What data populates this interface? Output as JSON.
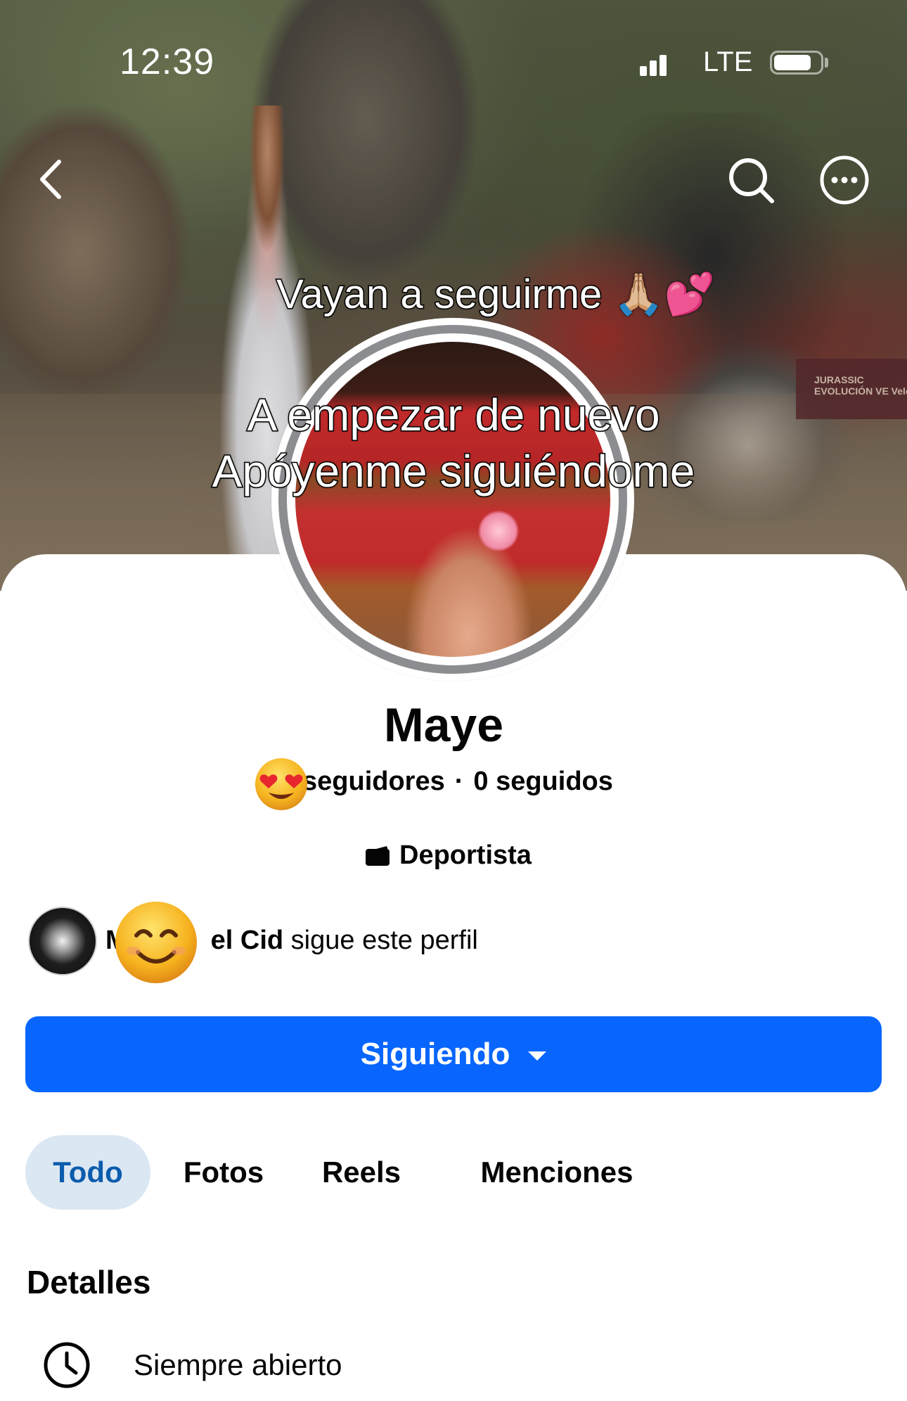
{
  "status_bar": {
    "time": "12:39",
    "network": "LTE"
  },
  "nav": {
    "back_icon": "chevron-left-icon",
    "search_icon": "search-icon",
    "more_icon": "more-horizontal-icon"
  },
  "cover": {
    "text_line_1": "Vayan a seguirme 🙏🏼💕",
    "text_line_2": "A empezar de nuevo",
    "text_line_3": "Apóyenme siguiéndome",
    "sign_text": "JURASSIC EVOLUCIÓN VE Velo"
  },
  "profile": {
    "name": "Maye",
    "followers_label": "seguidores",
    "separator": "·",
    "following_label": "0 seguidos",
    "category": "Deportista",
    "category_icon": "film-icon"
  },
  "mutual": {
    "name_prefix": "M",
    "name_suffix": "el Cid",
    "text": " sigue este perfil"
  },
  "actions": {
    "following_button": "Siguiendo"
  },
  "tabs": [
    {
      "label": "Todo",
      "active": true
    },
    {
      "label": "Fotos",
      "active": false
    },
    {
      "label": "Reels",
      "active": false
    },
    {
      "label": "Menciones",
      "active": false
    }
  ],
  "details": {
    "title": "Detalles",
    "items": [
      {
        "icon": "clock-icon",
        "text": "Siempre abierto"
      }
    ]
  },
  "colors": {
    "primary": "#0866ff",
    "active_tab_bg": "#dbe7f2",
    "active_tab_text": "#0b5cad"
  }
}
